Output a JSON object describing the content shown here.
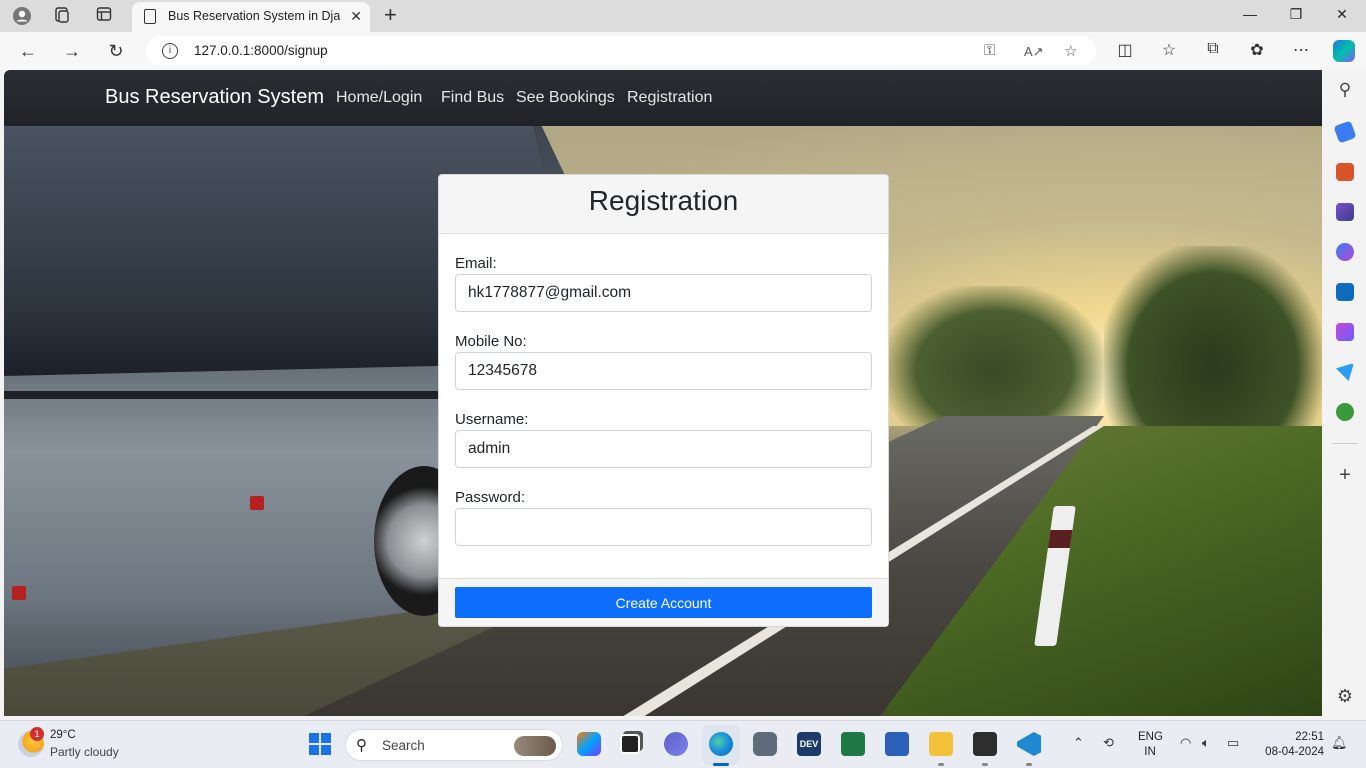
{
  "browser": {
    "tab_title": "Bus Reservation System in Django",
    "url": "127.0.0.1:8000/signup"
  },
  "app": {
    "brand": "Bus Reservation System",
    "nav": [
      "Home/Login",
      "Find Bus",
      "See Bookings",
      "Registration"
    ]
  },
  "form": {
    "title": "Registration",
    "fields": [
      {
        "label": "Email:",
        "value": "hk1778877@gmail.com"
      },
      {
        "label": "Mobile No:",
        "value": "12345678"
      },
      {
        "label": "Username:",
        "value": "admin"
      },
      {
        "label": "Password:",
        "value": ""
      }
    ],
    "submit_label": "Create Account",
    "accent_color": "#0d6efd"
  },
  "taskbar": {
    "weather_temp": "29°C",
    "weather_condition": "Partly cloudy",
    "weather_badge": "1",
    "search_placeholder": "Search",
    "lang_1": "ENG",
    "lang_2": "IN",
    "time": "22:51",
    "date": "08-04-2024"
  },
  "icons": {
    "tab_actions": [
      "profile-icon",
      "workspaces-icon",
      "tab-actions-icon"
    ],
    "toolbar": [
      "split-screen-icon",
      "favorites-icon",
      "collections-icon",
      "extensions-icon",
      "more-icon",
      "copilot-icon"
    ],
    "sidebar": [
      "search-icon",
      "shopping-icon",
      "tools-icon",
      "games-icon",
      "microsoft365-icon",
      "outlook-icon",
      "designer-icon",
      "send-icon",
      "tree-icon",
      "add-icon",
      "settings-icon"
    ]
  }
}
